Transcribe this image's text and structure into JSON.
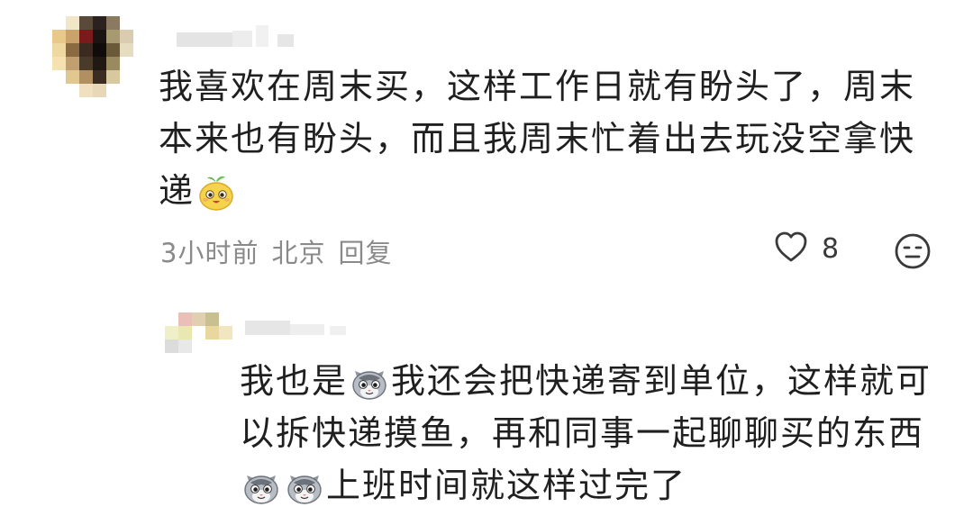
{
  "comment": {
    "text_lines": [
      "我喜欢在周末买，这样工作日就有盼头了，周末",
      "本来也有盼头，而且我周末忙着出去玩没空拿快",
      "递"
    ],
    "emoji": "yellow-sprout-face",
    "time": "3小时前",
    "location": "北京",
    "reply_label": "回复",
    "like_count": "8"
  },
  "reply": {
    "segments": {
      "line1_a": "我也是",
      "line1_b": "我还会把快递寄到单位，这样就可",
      "line2": "以拆快递摸鱼，再和同事一起聊聊买的东西",
      "line3": "上班时间就这样过完了"
    },
    "emoji": "gray-cat-face"
  },
  "colors": {
    "text": "#1f1f1f",
    "meta": "#8a8a8a",
    "icon": "#3a3a3a"
  }
}
